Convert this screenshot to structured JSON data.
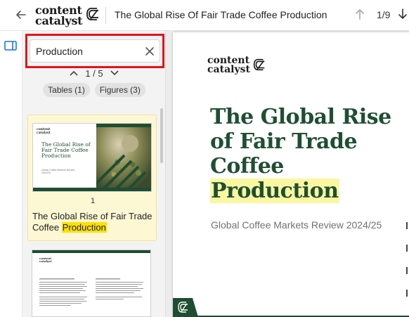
{
  "app": {
    "logo_line1": "content",
    "logo_line2": "catalyst",
    "document_title": "The Global Rise Of Fair Trade Coffee Production",
    "page_counter": "1/9"
  },
  "icons": {
    "back": "arrow-left-icon",
    "prev_page": "arrow-up-icon",
    "next_page": "arrow-down-icon",
    "panel_toggle": "sidebar-panel-icon",
    "clear": "close-icon",
    "prev_match": "chevron-up-icon",
    "next_match": "chevron-down-icon"
  },
  "search": {
    "value": "Production",
    "match_position": "1 / 5",
    "filters": [
      {
        "label": "Tables (1)"
      },
      {
        "label": "Figures (3)"
      }
    ]
  },
  "results": [
    {
      "page": "1",
      "text_before": "The Global Rise of Fair Trade Coffee ",
      "text_match": "Production",
      "thumbnail": {
        "logo_line1": "content",
        "logo_line2": "catalyst",
        "title": "The Global Rise of Fair Trade Coffee Production"
      }
    }
  ],
  "document_page": {
    "logo_line1": "content",
    "logo_line2": "catalyst",
    "title_lines": [
      "The Global Rise",
      "of Fair Trade",
      "Coffee"
    ],
    "title_highlight": "Production",
    "subtitle": "Global Coffee Markets Review 2024/25"
  },
  "colors": {
    "brand_green": "#1f4f32",
    "search_highlight": "#ffe000",
    "selection_outline": "#e0141c",
    "result_background": "#fdf7d3"
  }
}
